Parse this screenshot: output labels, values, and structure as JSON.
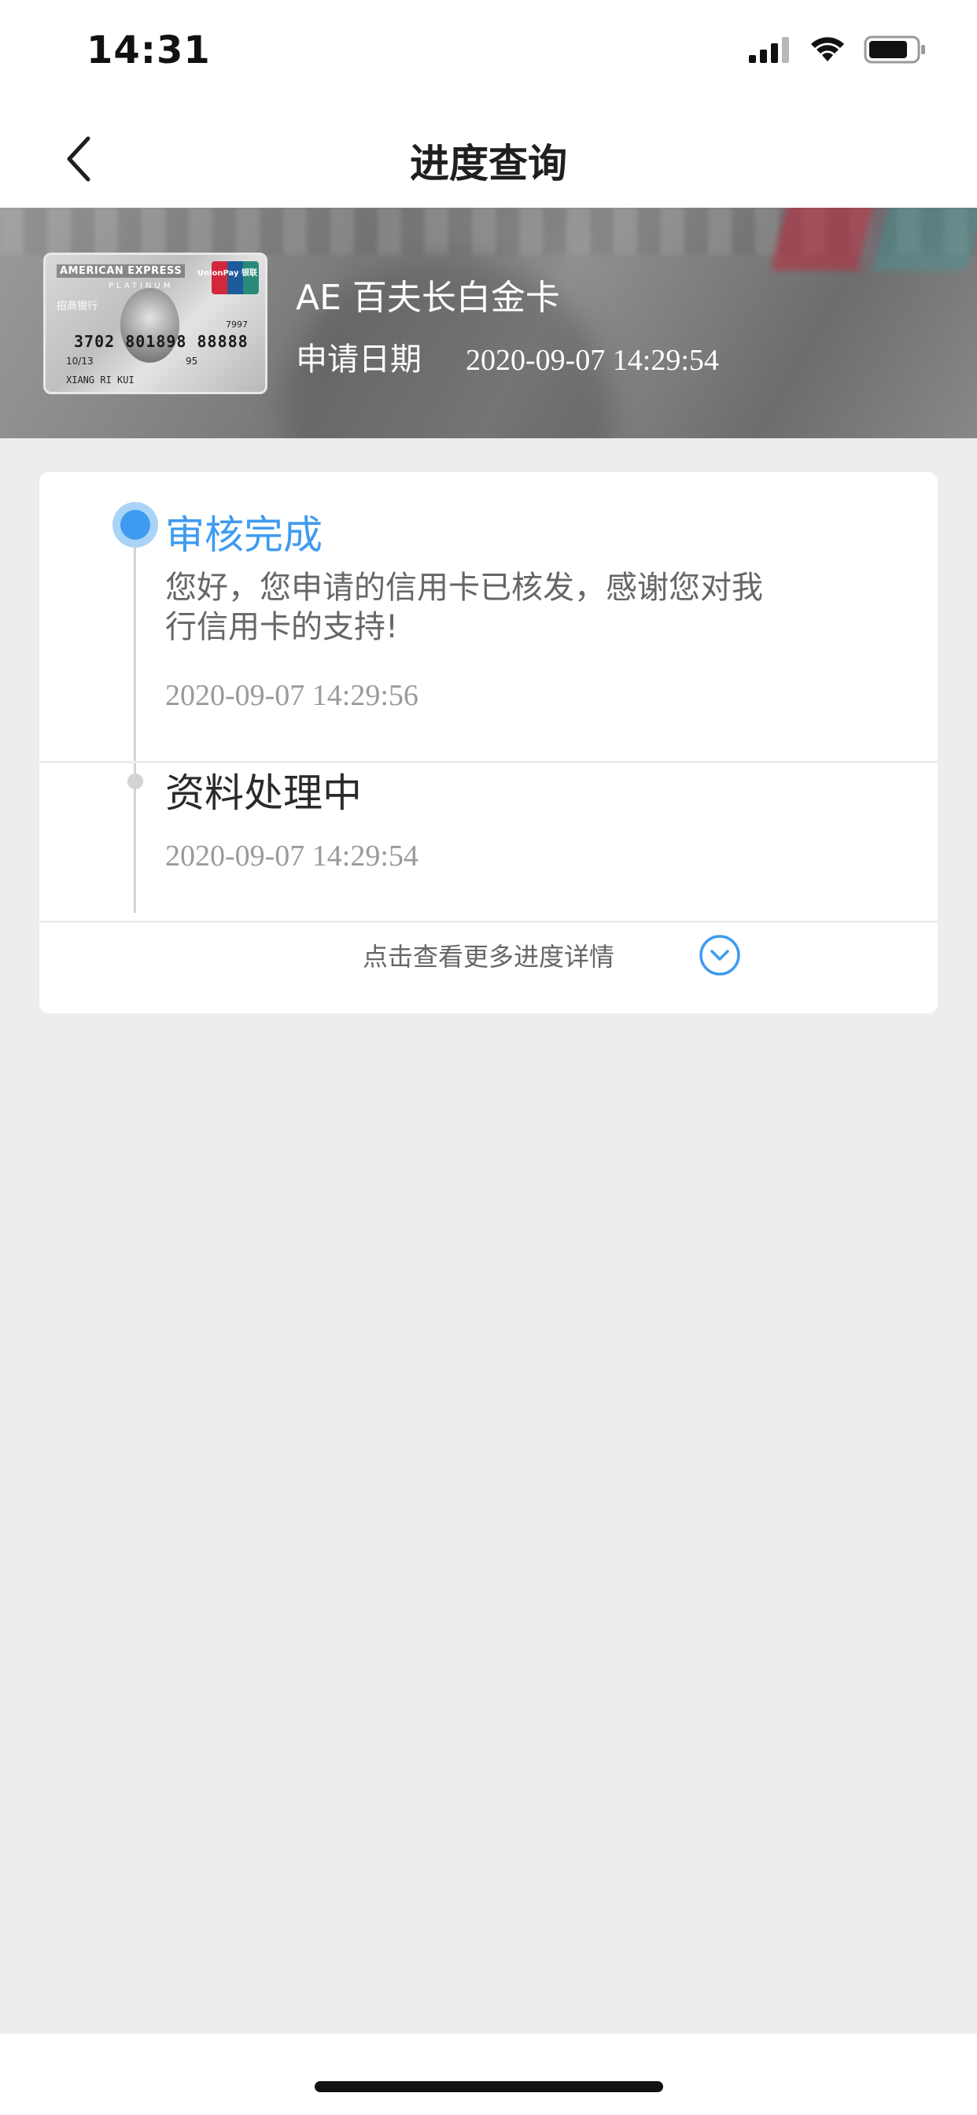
{
  "status_bar": {
    "time": "14:31"
  },
  "nav": {
    "title": "进度查询"
  },
  "card": {
    "thumbnail": {
      "brand": "AMERICAN EXPRESS",
      "tier": "PLATINUM",
      "bank": "招商银行",
      "network": "UnionPay 银联",
      "number": "3702 801898 88888",
      "number_suffix": "7997",
      "valid_thru": "10/13",
      "code": "95",
      "holder": "XIANG RI KUI"
    },
    "name": "AE 百夫长白金卡",
    "apply_label": "申请日期",
    "apply_date": "2020-09-07 14:29:54"
  },
  "progress": {
    "steps": [
      {
        "title": "审核完成",
        "description": "您好，您申请的信用卡已核发，感谢您对我行信用卡的支持!",
        "time": "2020-09-07 14:29:56",
        "active": true
      },
      {
        "title": "资料处理中",
        "time": "2020-09-07 14:29:54",
        "active": false
      }
    ],
    "more_label": "点击查看更多进度详情"
  },
  "colors": {
    "accent": "#3f9bf0",
    "background": "#ededed"
  }
}
